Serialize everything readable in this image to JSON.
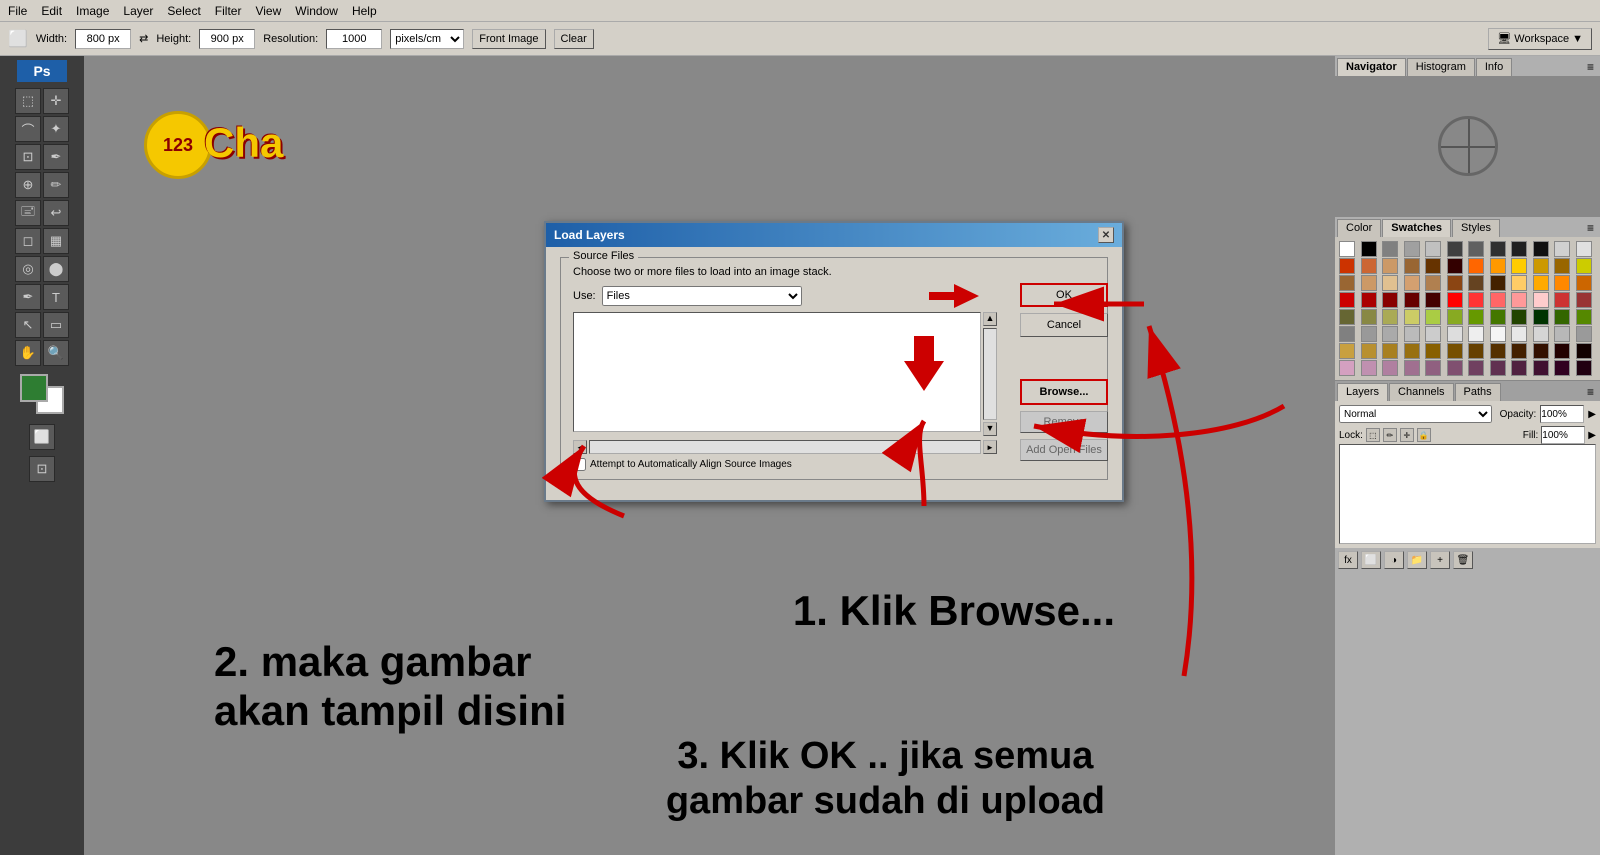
{
  "menubar": {
    "items": [
      "File",
      "Edit",
      "Image",
      "Layer",
      "Select",
      "Filter",
      "View",
      "Window",
      "Help"
    ]
  },
  "optionsbar": {
    "width_label": "Width:",
    "width_value": "800 px",
    "height_label": "Height:",
    "height_value": "900 px",
    "resolution_label": "Resolution:",
    "resolution_value": "1000",
    "resolution_unit": "pixels/cm",
    "front_image_btn": "Front Image",
    "clear_btn": "Clear",
    "workspace_label": "Workspace"
  },
  "dialog": {
    "title": "Load Layers",
    "source_files_label": "Source Files",
    "instruction": "Choose two or more files to load into an image stack.",
    "use_label": "Use:",
    "use_value": "Files",
    "ok_btn": "OK",
    "cancel_btn": "Cancel",
    "browse_btn": "Browse...",
    "remove_btn": "Remove",
    "add_open_files_btn": "Add Open Files",
    "checkbox_label": "Attempt to Automatically Align Source Images"
  },
  "instructions": {
    "step1": "1. Klik Browse...",
    "step2": "2. maka gambar\nakan tampil disini",
    "step3": "3. Klik OK .. jika semua\ngambar sudah di upload"
  },
  "right_panel": {
    "navigator_tab": "Navigator",
    "histogram_tab": "Histogram",
    "info_tab": "Info",
    "color_tab": "Color",
    "swatches_tab": "Swatches",
    "styles_tab": "Styles"
  },
  "layers_panel": {
    "layers_tab": "Layers",
    "channels_tab": "Channels",
    "paths_tab": "Paths",
    "blend_mode": "Normal",
    "opacity_label": "Opacity:",
    "opacity_value": "100%",
    "lock_label": "Lock:",
    "fill_label": "Fill:",
    "fill_value": "100%"
  },
  "swatches": [
    "#ffffff",
    "#000000",
    "#808080",
    "#a0a0a0",
    "#c0c0c0",
    "#404040",
    "#606060",
    "#303030",
    "#202020",
    "#101010",
    "#d0d0d0",
    "#e0e0e0",
    "#cc3300",
    "#cc6633",
    "#cc9966",
    "#996633",
    "#663300",
    "#330000",
    "#ff6600",
    "#ff9900",
    "#ffcc00",
    "#cc9900",
    "#996600",
    "#cccc00",
    "#996633",
    "#cc9966",
    "#e0c090",
    "#d4a070",
    "#b08050",
    "#8B4513",
    "#654321",
    "#432100",
    "#ffcc66",
    "#ffaa00",
    "#ff8800",
    "#cc6600",
    "#cc0000",
    "#aa0000",
    "#880000",
    "#660000",
    "#440000",
    "#ff0000",
    "#ff3333",
    "#ff6666",
    "#ff9999",
    "#ffcccc",
    "#cc3333",
    "#993333",
    "#666633",
    "#888844",
    "#aaaa55",
    "#cccc66",
    "#aacc44",
    "#88aa22",
    "#669900",
    "#447700",
    "#224400",
    "#003300",
    "#336600",
    "#558800",
    "#808080",
    "#999999",
    "#aaaaaa",
    "#bbbbbb",
    "#cccccc",
    "#dddddd",
    "#eeeeee",
    "#f5f5f5",
    "#e8e8e8",
    "#d5d5d5",
    "#b8b8b8",
    "#9a9a9a",
    "#c8a040",
    "#b89030",
    "#a88020",
    "#987010",
    "#886000",
    "#775000",
    "#664000",
    "#553000",
    "#442000",
    "#331000",
    "#220000",
    "#110000",
    "#d4a0c0",
    "#c090b0",
    "#b080a0",
    "#a07090",
    "#906080",
    "#805070",
    "#704060",
    "#603050",
    "#502040",
    "#401030",
    "#300020",
    "#200010"
  ]
}
